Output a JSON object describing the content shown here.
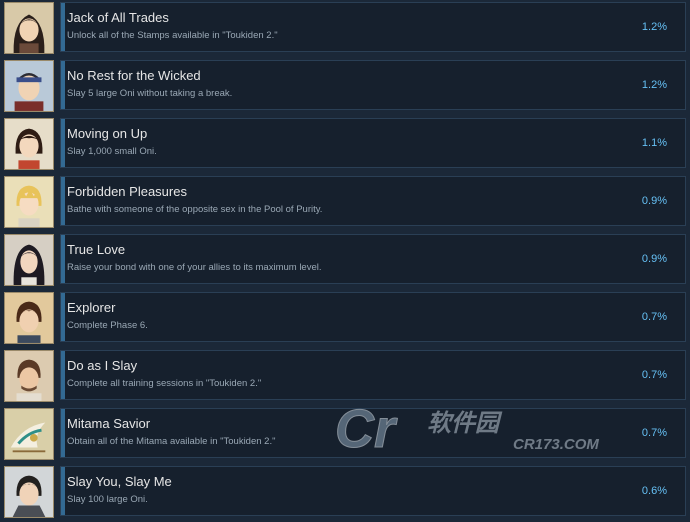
{
  "achievements": [
    {
      "title": "Jack of All Trades",
      "description": "Unlock all of the Stamps available in \"Toukiden 2.\"",
      "percent": "1.2%",
      "percent_value": 1.2,
      "icon": "warrior-long-hair-portrait-icon",
      "bg": "#d8c9a8"
    },
    {
      "title": "No Rest for the Wicked",
      "description": "Slay 5 large Oni without taking a break.",
      "percent": "1.2%",
      "percent_value": 1.2,
      "icon": "headband-warrior-portrait-icon",
      "bg": "#b9c9d8"
    },
    {
      "title": "Moving on Up",
      "description": "Slay 1,000 small Oni.",
      "percent": "1.1%",
      "percent_value": 1.1,
      "icon": "short-hair-girl-portrait-icon",
      "bg": "#e6ddc9"
    },
    {
      "title": "Forbidden Pleasures",
      "description": "Bathe with someone of the opposite sex in the Pool of Purity.",
      "percent": "0.9%",
      "percent_value": 0.9,
      "icon": "blonde-youth-portrait-icon",
      "bg": "#eadfb8"
    },
    {
      "title": "True Love",
      "description": "Raise your bond with one of your allies to its maximum level.",
      "percent": "0.9%",
      "percent_value": 0.9,
      "icon": "dark-hair-woman-portrait-icon",
      "bg": "#d6cfc4"
    },
    {
      "title": "Explorer",
      "description": "Complete Phase 6.",
      "percent": "0.7%",
      "percent_value": 0.7,
      "icon": "young-man-portrait-icon",
      "bg": "#e2c99c"
    },
    {
      "title": "Do as I Slay",
      "description": "Complete all training sessions in \"Toukiden 2.\"",
      "percent": "0.7%",
      "percent_value": 0.7,
      "icon": "older-man-portrait-icon",
      "bg": "#dccbb0"
    },
    {
      "title": "Mitama Savior",
      "description": "Obtain all of the Mitama available in \"Toukiden 2.\"",
      "percent": "0.7%",
      "percent_value": 0.7,
      "icon": "mitama-bird-icon",
      "bg": "#d9cfa8"
    },
    {
      "title": "Slay You, Slay Me",
      "description": "Slay 100 large Oni.",
      "percent": "0.6%",
      "percent_value": 0.6,
      "icon": "armored-youth-portrait-icon",
      "bg": "#d2d6d8"
    }
  ],
  "watermark": {
    "main": "Cr",
    "site": "CR173.COM",
    "logo_text": "软件园"
  },
  "colors": {
    "background": "#1b2838",
    "percent_text": "#66c0f4",
    "progress_fill": "#1f4a6b"
  }
}
